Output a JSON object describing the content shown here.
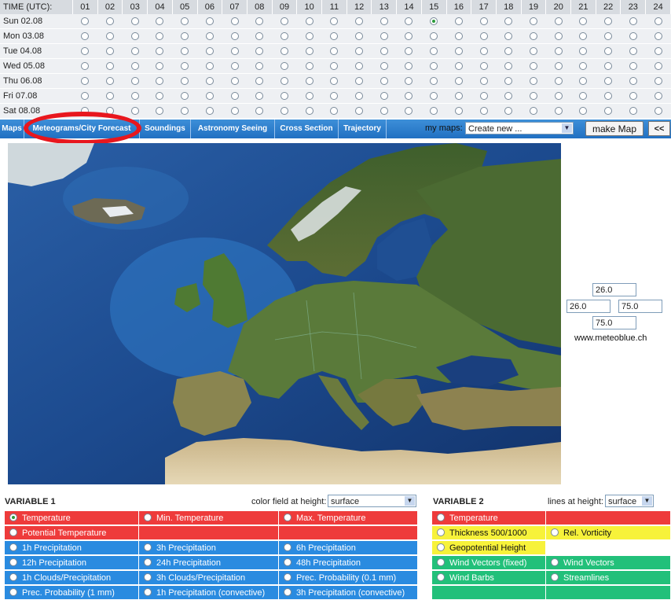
{
  "time_grid": {
    "header_label": "TIME (UTC):",
    "hours": [
      "01",
      "02",
      "03",
      "04",
      "05",
      "06",
      "07",
      "08",
      "09",
      "10",
      "11",
      "12",
      "13",
      "14",
      "15",
      "16",
      "17",
      "18",
      "19",
      "20",
      "21",
      "22",
      "23",
      "24"
    ],
    "days": [
      "Sun 02.08",
      "Mon 03.08",
      "Tue 04.08",
      "Wed 05.08",
      "Thu 06.08",
      "Fri 07.08",
      "Sat 08.08"
    ],
    "selected_day": 0,
    "selected_hour": 14
  },
  "tabs": [
    {
      "label": "Maps"
    },
    {
      "label": "Meteograms/City Forecast"
    },
    {
      "label": "Soundings"
    },
    {
      "label": "Astronomy Seeing"
    },
    {
      "label": "Cross Section"
    },
    {
      "label": "Trajectory"
    }
  ],
  "my_maps": {
    "label": "my maps:",
    "selected": "Create new ..."
  },
  "make_map_label": "make Map",
  "collapse_label": "<<",
  "bbox": {
    "north": "26.0",
    "west": "26.0",
    "east": "75.0",
    "south": "75.0"
  },
  "watermark": "www.meteoblue.ch",
  "variable1": {
    "title": "VARIABLE 1",
    "height_label": "color field at height:",
    "height_value": "surface",
    "rows": [
      [
        {
          "label": "Temperature",
          "color": "red",
          "selected": true
        },
        {
          "label": "Min. Temperature",
          "color": "red"
        },
        {
          "label": "Max. Temperature",
          "color": "red"
        }
      ],
      [
        {
          "label": "Potential Temperature",
          "color": "red"
        },
        {
          "label": "",
          "color": "red"
        },
        {
          "label": "",
          "color": "red"
        }
      ],
      [
        {
          "label": "1h Precipitation",
          "color": "blue"
        },
        {
          "label": "3h Precipitation",
          "color": "blue"
        },
        {
          "label": "6h Precipitation",
          "color": "blue"
        }
      ],
      [
        {
          "label": "12h Precipitation",
          "color": "blue"
        },
        {
          "label": "24h Precipitation",
          "color": "blue"
        },
        {
          "label": "48h Precipitation",
          "color": "blue"
        }
      ],
      [
        {
          "label": "1h Clouds/Precipitation",
          "color": "blue"
        },
        {
          "label": "3h Clouds/Precipitation",
          "color": "blue"
        },
        {
          "label": "Prec. Probability (0.1 mm)",
          "color": "blue"
        }
      ],
      [
        {
          "label": "Prec. Probability (1 mm)",
          "color": "blue"
        },
        {
          "label": "1h Precipitation (convective)",
          "color": "blue"
        },
        {
          "label": "3h Precipitation (convective)",
          "color": "blue"
        }
      ]
    ]
  },
  "variable2": {
    "title": "VARIABLE 2",
    "height_label": "lines at height:",
    "height_value": "surface",
    "rows": [
      [
        {
          "label": "Temperature",
          "color": "red"
        },
        {
          "label": "",
          "color": "red"
        }
      ],
      [
        {
          "label": "Thickness 500/1000",
          "color": "yellow"
        },
        {
          "label": "Rel. Vorticity",
          "color": "yellow"
        }
      ],
      [
        {
          "label": "Geopotential Height",
          "color": "yellow"
        },
        {
          "label": "",
          "color": "white"
        }
      ],
      [
        {
          "label": "Wind Vectors (fixed)",
          "color": "green"
        },
        {
          "label": "Wind Vectors",
          "color": "green"
        }
      ],
      [
        {
          "label": "Wind Barbs",
          "color": "green"
        },
        {
          "label": "Streamlines",
          "color": "green"
        }
      ],
      [
        {
          "label": "",
          "color": "green"
        },
        {
          "label": "",
          "color": "green"
        }
      ]
    ]
  }
}
